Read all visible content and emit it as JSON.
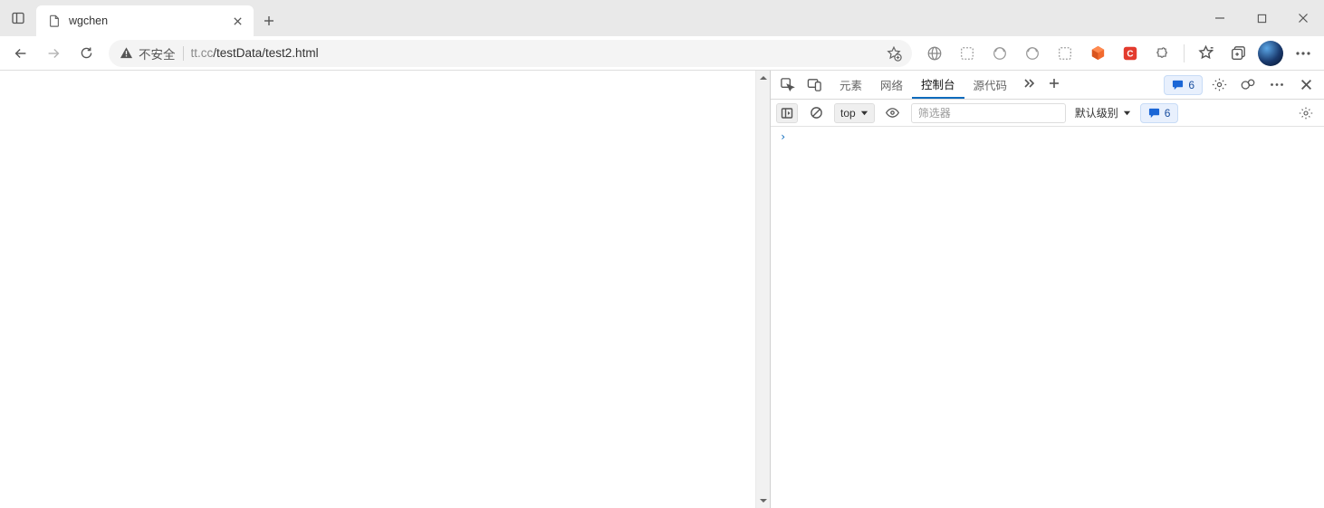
{
  "tab": {
    "title": "wgchen"
  },
  "address": {
    "warning_text": "不安全",
    "url_dim": "tt.cc",
    "url_rest": "/testData/test2.html"
  },
  "devtools": {
    "tabs": {
      "elements": "元素",
      "network": "网络",
      "console": "控制台",
      "sources": "源代码"
    },
    "issues_count": "6",
    "console": {
      "context": "top",
      "filter_placeholder": "筛选器",
      "level_label": "默认级别",
      "messages_count": "6"
    }
  }
}
